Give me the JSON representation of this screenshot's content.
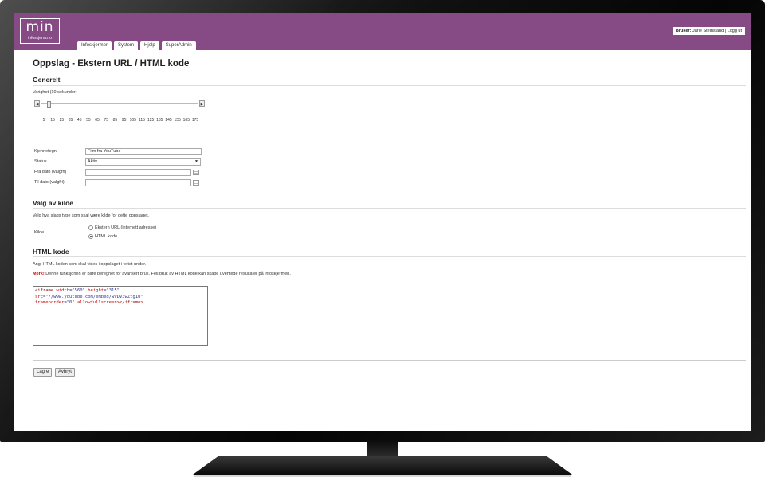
{
  "app": {
    "logo_main": "min",
    "logo_sub": "infoskjerm.no",
    "user_label": "Bruker:",
    "user_name": "Jarle Steinsland",
    "separator": "|",
    "logout": "Logg ut",
    "accent_color": "#864a85"
  },
  "tabs": [
    {
      "label": "Infoskjermer"
    },
    {
      "label": "System"
    },
    {
      "label": "Hjelp"
    },
    {
      "label": "SuperAdmin"
    }
  ],
  "page": {
    "title": "Oppslag - Ekstern URL / HTML kode"
  },
  "general": {
    "heading": "Generelt",
    "duration_label": "Varighet (10 sekunder)",
    "duration_value": 10,
    "slider_min": 5,
    "slider_max": 175,
    "ticks": [
      "5",
      "15",
      "25",
      "35",
      "45",
      "55",
      "65",
      "75",
      "85",
      "95",
      "105",
      "115",
      "125",
      "135",
      "145",
      "155",
      "165",
      "175"
    ],
    "fields": {
      "name_label": "Kjennetegn",
      "name_value": "Film fra YouTube",
      "status_label": "Status",
      "status_value": "Aktiv",
      "from_label": "Fra dato (valgfri)",
      "from_value": "",
      "to_label": "Til dato (valgfri)",
      "to_value": ""
    }
  },
  "source": {
    "heading": "Valg av kilde",
    "description": "Velg hva slags type som skal være kilde for dette oppslaget.",
    "label": "Kilde",
    "options": [
      {
        "label": "Ekstern URL (internett adresse)",
        "selected": false
      },
      {
        "label": "HTML kode",
        "selected": true
      }
    ]
  },
  "html": {
    "heading": "HTML kode",
    "description": "Angi HTML koden som skal vises i oppslaget i feltet under.",
    "warning_bold": "Merk!",
    "warning_text": "Denne funksjonen er bare beregnet for avansert bruk. Feil bruk av HTML kode kan skape uventede resultater på infoskjermen.",
    "code_line1_tag": "<iframe",
    "code_line1_attr1": "width",
    "code_line1_val1": "=\"560\"",
    "code_line1_attr2": "height",
    "code_line1_val2": "=\"315\"",
    "code_line2_attr": "src",
    "code_line2_val": "=\"//www.youtube.com/embed/wvDV3wZtg1U\"",
    "code_line3_attr1": "frameborder",
    "code_line3_val1": "=\"0\"",
    "code_line3_attr2": "allowfullscreen",
    "code_line3_end": "></",
    "code_line3_tag": "iframe",
    "code_line3_close": ">"
  },
  "actions": {
    "save": "Lagre",
    "cancel": "Avbryt"
  }
}
